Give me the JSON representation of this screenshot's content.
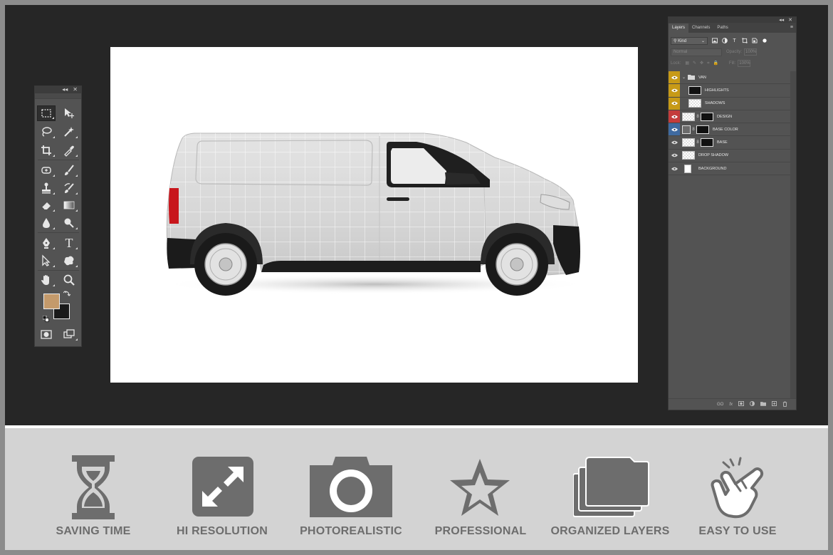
{
  "tools_panel": {
    "collapse_glyph": "◂◂",
    "close_glyph": "✕",
    "tools": [
      {
        "name": "rectangular-marquee-icon",
        "selected": true
      },
      {
        "name": "move-icon"
      },
      {
        "name": "lasso-icon"
      },
      {
        "name": "magic-wand-icon"
      },
      {
        "name": "crop-icon"
      },
      {
        "name": "eyedropper-icon"
      },
      {
        "name": "spot-healing-icon"
      },
      {
        "name": "brush-icon"
      },
      {
        "name": "clone-stamp-icon"
      },
      {
        "name": "history-brush-icon"
      },
      {
        "name": "eraser-icon"
      },
      {
        "name": "gradient-icon"
      },
      {
        "name": "blur-icon"
      },
      {
        "name": "dodge-icon"
      },
      {
        "name": "pen-icon"
      },
      {
        "name": "type-icon"
      },
      {
        "name": "path-selection-icon"
      },
      {
        "name": "custom-shape-icon"
      },
      {
        "name": "hand-icon"
      },
      {
        "name": "zoom-icon"
      },
      {
        "name": "quick-mask-icon"
      },
      {
        "name": "screen-mode-icon"
      }
    ],
    "type_glyph": "T",
    "foreground_color": "#c49a6b",
    "background_color": "#1a1a1a"
  },
  "layers_panel": {
    "collapse_glyph": "◂◂",
    "close_glyph": "✕",
    "menu_glyph": "≡",
    "tabs": [
      "Layers",
      "Channels",
      "Paths"
    ],
    "active_tab": "Layers",
    "filter_kind": "Kind",
    "filter_type_glyph": "T",
    "blend_mode": "Normal",
    "opacity_label": "Opacity:",
    "opacity_value": "100%",
    "lock_label": "Lock:",
    "fill_label": "Fill:",
    "fill_value": "100%",
    "chain_glyph": "8",
    "layers": [
      {
        "name": "VAN",
        "type": "group",
        "eye_color": "#c79a17"
      },
      {
        "name": "HIGHLIGHTS",
        "eye_color": "#c79a17"
      },
      {
        "name": "SHADOWS",
        "eye_color": "#c79a17"
      },
      {
        "name": "DESIGN",
        "eye_color": "#c43c3c"
      },
      {
        "name": "BASE COLOR",
        "eye_color": "#3f6aa0"
      },
      {
        "name": "BASE"
      },
      {
        "name": "DROP SHADOW"
      },
      {
        "name": "BACKGROUND"
      }
    ],
    "footer_icons": [
      "link-icon",
      "fx-icon",
      "mask-icon",
      "adjustment-icon",
      "folder-icon",
      "new-layer-icon",
      "trash-icon"
    ],
    "footer_link": "GO",
    "footer_fx": "fx"
  },
  "features": [
    {
      "label": "SAVING TIME",
      "icon": "hourglass-icon"
    },
    {
      "label": "HI RESOLUTION",
      "icon": "expand-arrows-icon"
    },
    {
      "label": "PHOTOREALISTIC",
      "icon": "camera-icon"
    },
    {
      "label": "PROFESSIONAL",
      "icon": "star-icon"
    },
    {
      "label": "ORGANIZED LAYERS",
      "icon": "stacked-folders-icon"
    },
    {
      "label": "EASY TO USE",
      "icon": "tap-hand-icon"
    }
  ],
  "colors": {
    "frame": "#8c8c8c",
    "workspace": "#262626",
    "feature_band": "#d3d3d3",
    "feature_icon": "#6d6d6d",
    "panel": "#535353"
  }
}
